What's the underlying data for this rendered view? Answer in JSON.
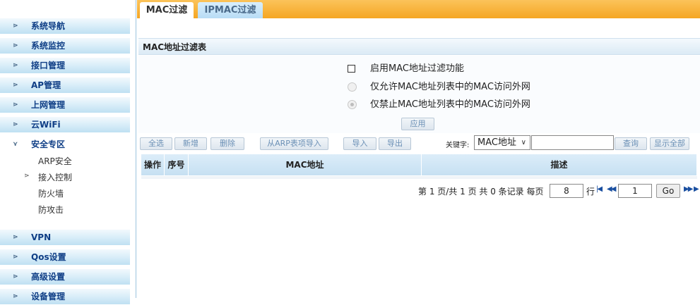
{
  "tabs": [
    {
      "label": "MAC过滤"
    },
    {
      "label": "IPMAC过滤"
    }
  ],
  "sidebar": {
    "items": [
      {
        "label": "系统导航"
      },
      {
        "label": "系统监控"
      },
      {
        "label": "接口管理"
      },
      {
        "label": "AP管理"
      },
      {
        "label": "上网管理"
      },
      {
        "label": "云WiFi"
      },
      {
        "label": "安全专区"
      },
      {
        "label": "VPN"
      },
      {
        "label": "Qos设置"
      },
      {
        "label": "高级设置"
      },
      {
        "label": "设备管理"
      }
    ],
    "sub_items": [
      {
        "label": "ARP安全"
      },
      {
        "label": "接入控制"
      },
      {
        "label": "防火墙"
      },
      {
        "label": "防攻击"
      }
    ]
  },
  "section": {
    "title": "MAC地址过滤表"
  },
  "settings": {
    "enable_label": "启用MAC地址过滤功能",
    "enable_checked": false,
    "allow_label": "仅允许MAC地址列表中的MAC访问外网",
    "deny_label": "仅禁止MAC地址列表中的MAC访问外网",
    "selected_mode": "deny",
    "apply_label": "应用"
  },
  "toolbar": {
    "select_all": "全选",
    "add": "新增",
    "delete": "删除",
    "import_arp": "从ARP表项导入",
    "import": "导入",
    "export": "导出",
    "keyword_label": "关键字:",
    "keyword_option": "MAC地址",
    "search_value": "",
    "query": "查询",
    "show_all": "显示全部"
  },
  "table": {
    "columns": [
      "操作",
      "序号",
      "MAC地址",
      "描述"
    ],
    "rows": []
  },
  "pager": {
    "summary": "第 1 页/共 1 页 共 0 条记录 每页",
    "per_page": "8",
    "rows_unit": "行",
    "page": "1",
    "go": "Go"
  }
}
